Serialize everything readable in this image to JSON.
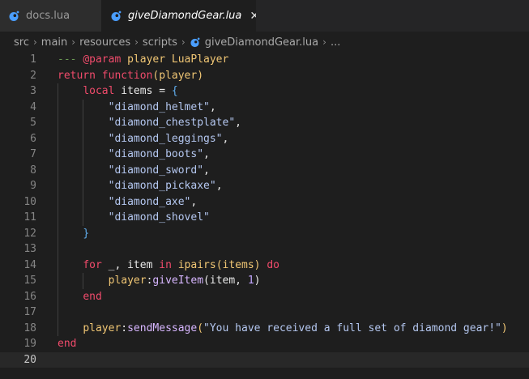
{
  "tabs": [
    {
      "label": "docs.lua",
      "active": false
    },
    {
      "label": "giveDiamondGear.lua",
      "active": true,
      "close_glyph": "✕"
    }
  ],
  "breadcrumb": {
    "items": [
      "src",
      "main",
      "resources",
      "scripts",
      "giveDiamondGear.lua",
      "..."
    ]
  },
  "icons": {
    "tab_file_icon": "lua-file-icon",
    "accent": "#4a9eff"
  },
  "editor": {
    "current_line": 20,
    "line_numbers": [
      "1",
      "2",
      "3",
      "4",
      "5",
      "6",
      "7",
      "8",
      "9",
      "10",
      "11",
      "12",
      "13",
      "14",
      "15",
      "16",
      "17",
      "18",
      "19",
      "20"
    ],
    "lines": [
      [
        {
          "t": "--- ",
          "c": "c-comment"
        },
        {
          "t": "@param",
          "c": "c-kw"
        },
        {
          "t": " player LuaPlayer",
          "c": "c-param"
        }
      ],
      [
        {
          "t": "return function",
          "c": "c-kw"
        },
        {
          "t": "(player)",
          "c": "c-param"
        }
      ],
      [
        {
          "t": "    "
        },
        {
          "t": "local",
          "c": "c-kw"
        },
        {
          "t": " items = ",
          "c": "c-plain"
        },
        {
          "t": "{",
          "c": "c-brace"
        }
      ],
      [
        {
          "t": "        "
        },
        {
          "t": "\"diamond_helmet\"",
          "c": "c-str"
        },
        {
          "t": ",",
          "c": "c-plain"
        }
      ],
      [
        {
          "t": "        "
        },
        {
          "t": "\"diamond_chestplate\"",
          "c": "c-str"
        },
        {
          "t": ",",
          "c": "c-plain"
        }
      ],
      [
        {
          "t": "        "
        },
        {
          "t": "\"diamond_leggings\"",
          "c": "c-str"
        },
        {
          "t": ",",
          "c": "c-plain"
        }
      ],
      [
        {
          "t": "        "
        },
        {
          "t": "\"diamond_boots\"",
          "c": "c-str"
        },
        {
          "t": ",",
          "c": "c-plain"
        }
      ],
      [
        {
          "t": "        "
        },
        {
          "t": "\"diamond_sword\"",
          "c": "c-str"
        },
        {
          "t": ",",
          "c": "c-plain"
        }
      ],
      [
        {
          "t": "        "
        },
        {
          "t": "\"diamond_pickaxe\"",
          "c": "c-str"
        },
        {
          "t": ",",
          "c": "c-plain"
        }
      ],
      [
        {
          "t": "        "
        },
        {
          "t": "\"diamond_axe\"",
          "c": "c-str"
        },
        {
          "t": ",",
          "c": "c-plain"
        }
      ],
      [
        {
          "t": "        "
        },
        {
          "t": "\"diamond_shovel\"",
          "c": "c-str"
        }
      ],
      [
        {
          "t": "    "
        },
        {
          "t": "}",
          "c": "c-brace"
        }
      ],
      [],
      [
        {
          "t": "    "
        },
        {
          "t": "for",
          "c": "c-kw"
        },
        {
          "t": " _, item ",
          "c": "c-plain"
        },
        {
          "t": "in",
          "c": "c-kw"
        },
        {
          "t": " ipairs(items) ",
          "c": "c-param"
        },
        {
          "t": "do",
          "c": "c-kw"
        }
      ],
      [
        {
          "t": "        "
        },
        {
          "t": "player",
          "c": "c-var"
        },
        {
          "t": ":",
          "c": "c-plain"
        },
        {
          "t": "giveItem",
          "c": "c-method"
        },
        {
          "t": "(item, ",
          "c": "c-plain"
        },
        {
          "t": "1",
          "c": "c-num"
        },
        {
          "t": ")",
          "c": "c-plain"
        }
      ],
      [
        {
          "t": "    "
        },
        {
          "t": "end",
          "c": "c-kw"
        }
      ],
      [],
      [
        {
          "t": "    "
        },
        {
          "t": "player",
          "c": "c-var"
        },
        {
          "t": ":",
          "c": "c-plain"
        },
        {
          "t": "sendMessage",
          "c": "c-method"
        },
        {
          "t": "(",
          "c": "c-paren"
        },
        {
          "t": "\"You have received a full set of diamond gear!\"",
          "c": "c-str"
        },
        {
          "t": ")",
          "c": "c-paren"
        }
      ],
      [
        {
          "t": "end",
          "c": "c-kw"
        }
      ],
      []
    ],
    "indent_guides": [
      {
        "line": 3,
        "levels": [
          1
        ]
      },
      {
        "line": 4,
        "levels": [
          1,
          2
        ]
      },
      {
        "line": 5,
        "levels": [
          1,
          2
        ]
      },
      {
        "line": 6,
        "levels": [
          1,
          2
        ]
      },
      {
        "line": 7,
        "levels": [
          1,
          2
        ]
      },
      {
        "line": 8,
        "levels": [
          1,
          2
        ]
      },
      {
        "line": 9,
        "levels": [
          1,
          2
        ]
      },
      {
        "line": 10,
        "levels": [
          1,
          2
        ]
      },
      {
        "line": 11,
        "levels": [
          1,
          2
        ]
      },
      {
        "line": 12,
        "levels": [
          1
        ]
      },
      {
        "line": 13,
        "levels": [
          1
        ]
      },
      {
        "line": 14,
        "levels": [
          1
        ]
      },
      {
        "line": 15,
        "levels": [
          1,
          2
        ]
      },
      {
        "line": 16,
        "levels": [
          1
        ]
      },
      {
        "line": 17,
        "levels": [
          1
        ]
      },
      {
        "line": 18,
        "levels": [
          1
        ]
      }
    ]
  }
}
